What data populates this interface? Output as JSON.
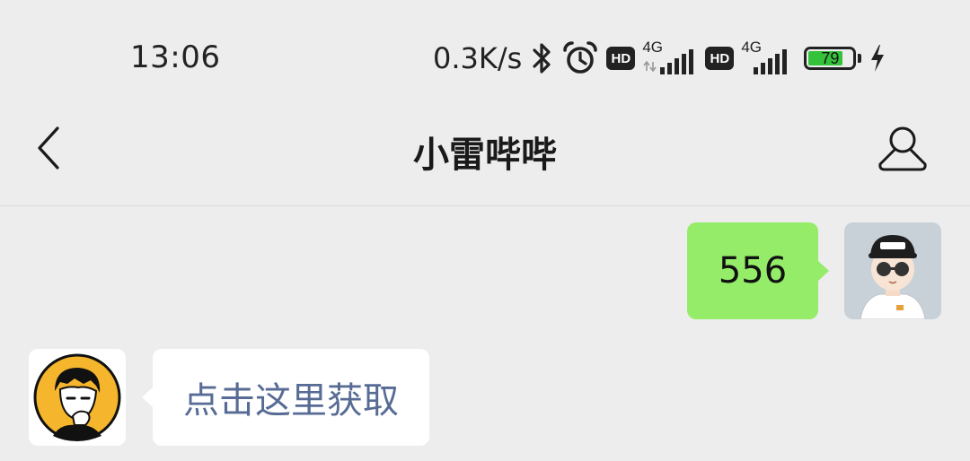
{
  "status_bar": {
    "time": "13:06",
    "net_speed": "0.3K/s",
    "sim1": {
      "hd": "HD",
      "network": "4G"
    },
    "sim2": {
      "hd": "HD",
      "network": "4G"
    },
    "battery_level": "79",
    "icons": [
      "bluetooth-icon",
      "alarm-icon",
      "charging-icon"
    ]
  },
  "nav": {
    "title": "小雷哔哔",
    "back_icon": "chevron-left-icon",
    "profile_icon": "person-icon"
  },
  "messages": [
    {
      "sender": "me",
      "text": "556"
    },
    {
      "sender": "other",
      "text": "点击这里获取"
    }
  ],
  "colors": {
    "background": "#ededed",
    "outgoing_bubble": "#95ec69",
    "incoming_bubble": "#ffffff",
    "link_text": "#576b95",
    "battery_fill": "#35c23b"
  }
}
